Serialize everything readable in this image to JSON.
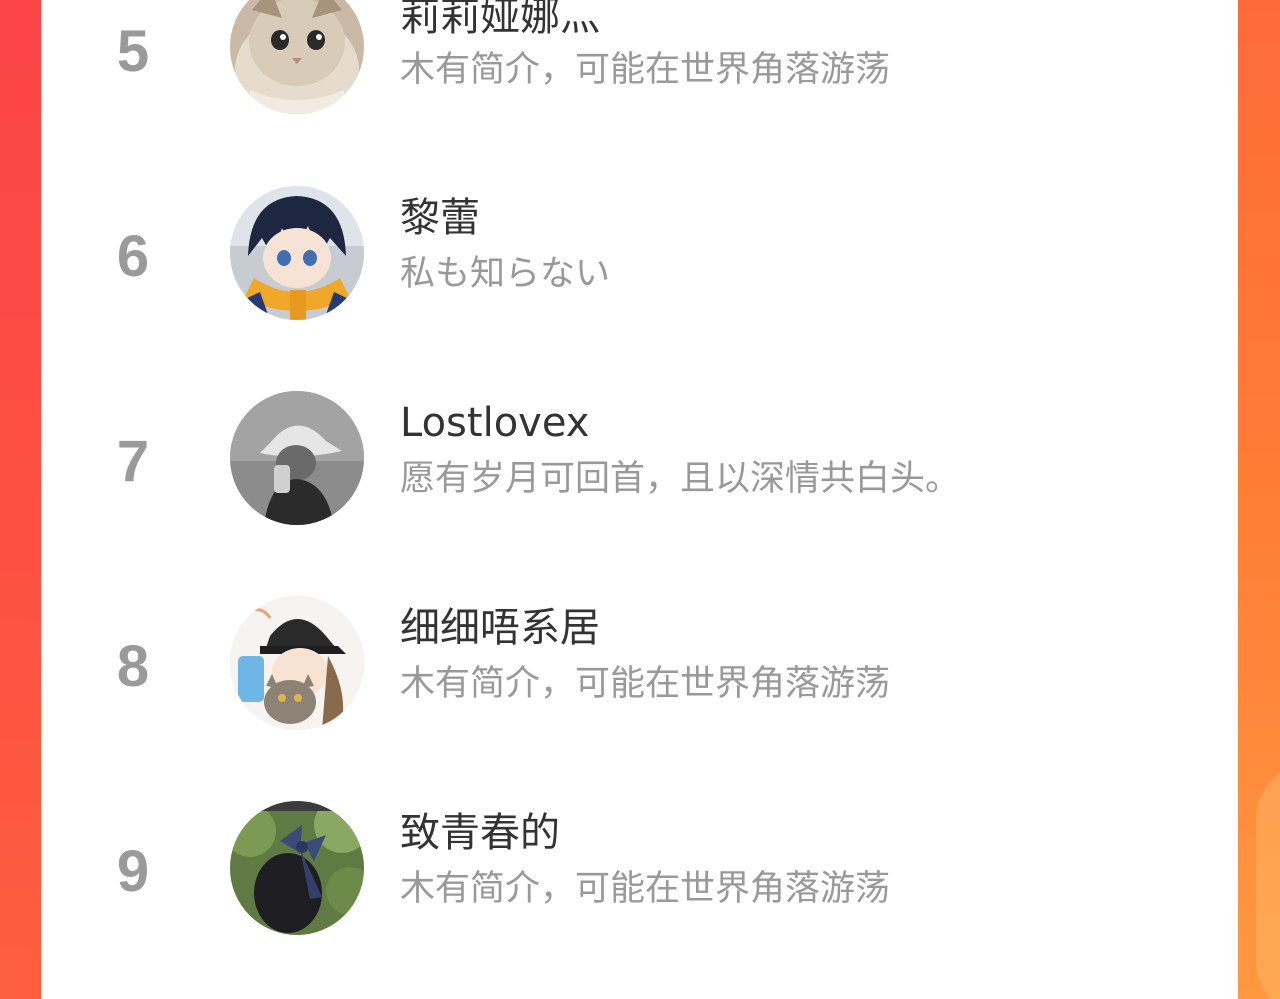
{
  "ranking": {
    "items": [
      {
        "rank": "5",
        "name": "莉莉娅娜灬",
        "bio": "木有简介，可能在世界角落游荡",
        "avatar_icon": "cat-photo-avatar"
      },
      {
        "rank": "6",
        "name": "黎蕾",
        "bio": "私も知らない",
        "avatar_icon": "anime-boy-scarf-avatar"
      },
      {
        "rank": "7",
        "name": "Lostlovex",
        "bio": "愿有岁月可回首，且以深情共白头。",
        "avatar_icon": "girl-bucket-hat-avatar"
      },
      {
        "rank": "8",
        "name": "细细唔系居",
        "bio": "木有简介，可能在世界角落游荡",
        "avatar_icon": "girl-cap-cat-avatar"
      },
      {
        "rank": "9",
        "name": "致青春的",
        "bio": "木有简介，可能在世界角落游荡",
        "avatar_icon": "hair-bow-photo-avatar"
      }
    ]
  },
  "colors": {
    "left_edge": "#fb4446",
    "right_edge": "#ff7d35",
    "rank_text": "#9a9a9a",
    "name_text": "#333333",
    "bio_text": "#999999"
  }
}
